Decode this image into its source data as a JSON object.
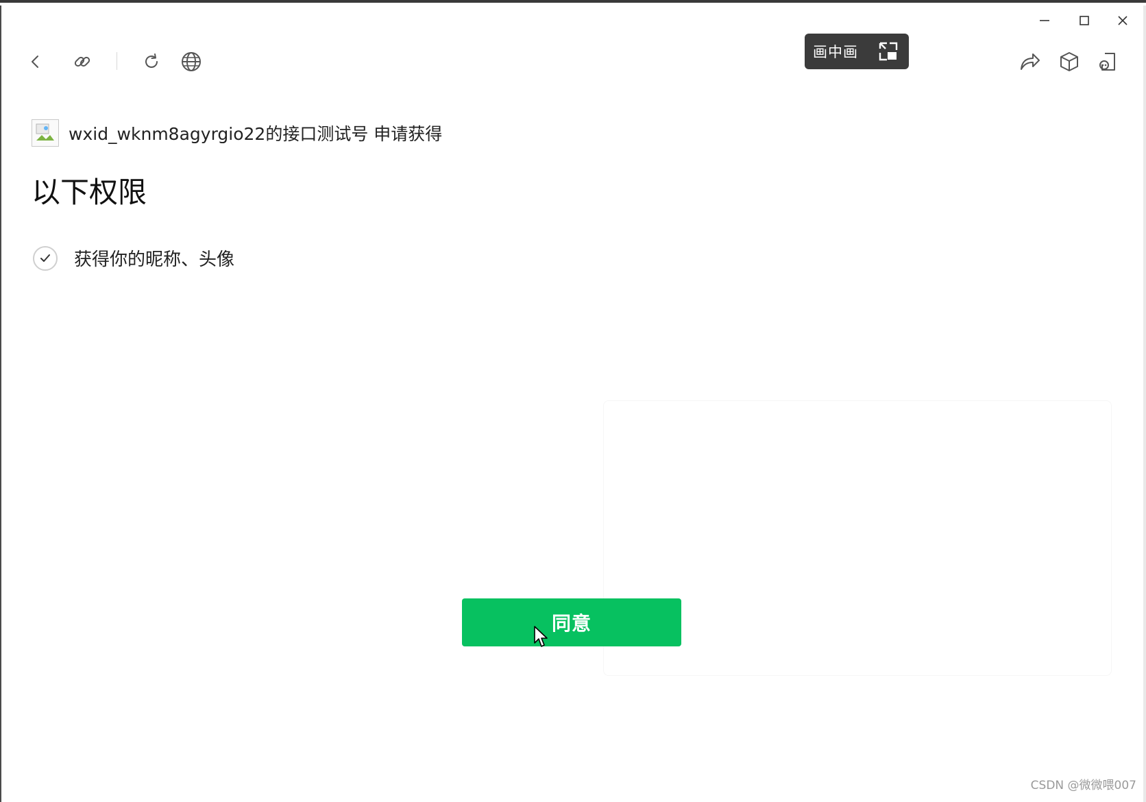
{
  "window_controls": {
    "minimize_icon": "minimize-icon",
    "maximize_icon": "maximize-icon",
    "close_icon": "close-icon"
  },
  "toolbar": {
    "back_icon": "back-icon",
    "link_icon": "link-icon",
    "refresh_icon": "refresh-icon",
    "globe_icon": "globe-icon",
    "share_icon": "share-icon",
    "cube_icon": "cube-icon",
    "mini_program_icon": "mini-program-icon"
  },
  "pip": {
    "label": "画中画",
    "icon": "pip-icon"
  },
  "content": {
    "app_line": "wxid_wknm8agyrgio22的接口测试号 申请获得",
    "heading": "以下权限",
    "permissions": [
      {
        "label": "获得你的昵称、头像",
        "checked": true
      }
    ],
    "agree_button": "同意"
  },
  "colors": {
    "accent": "#07c160",
    "pip_background": "#3b3b3b"
  },
  "watermark": "CSDN @微微喂007"
}
